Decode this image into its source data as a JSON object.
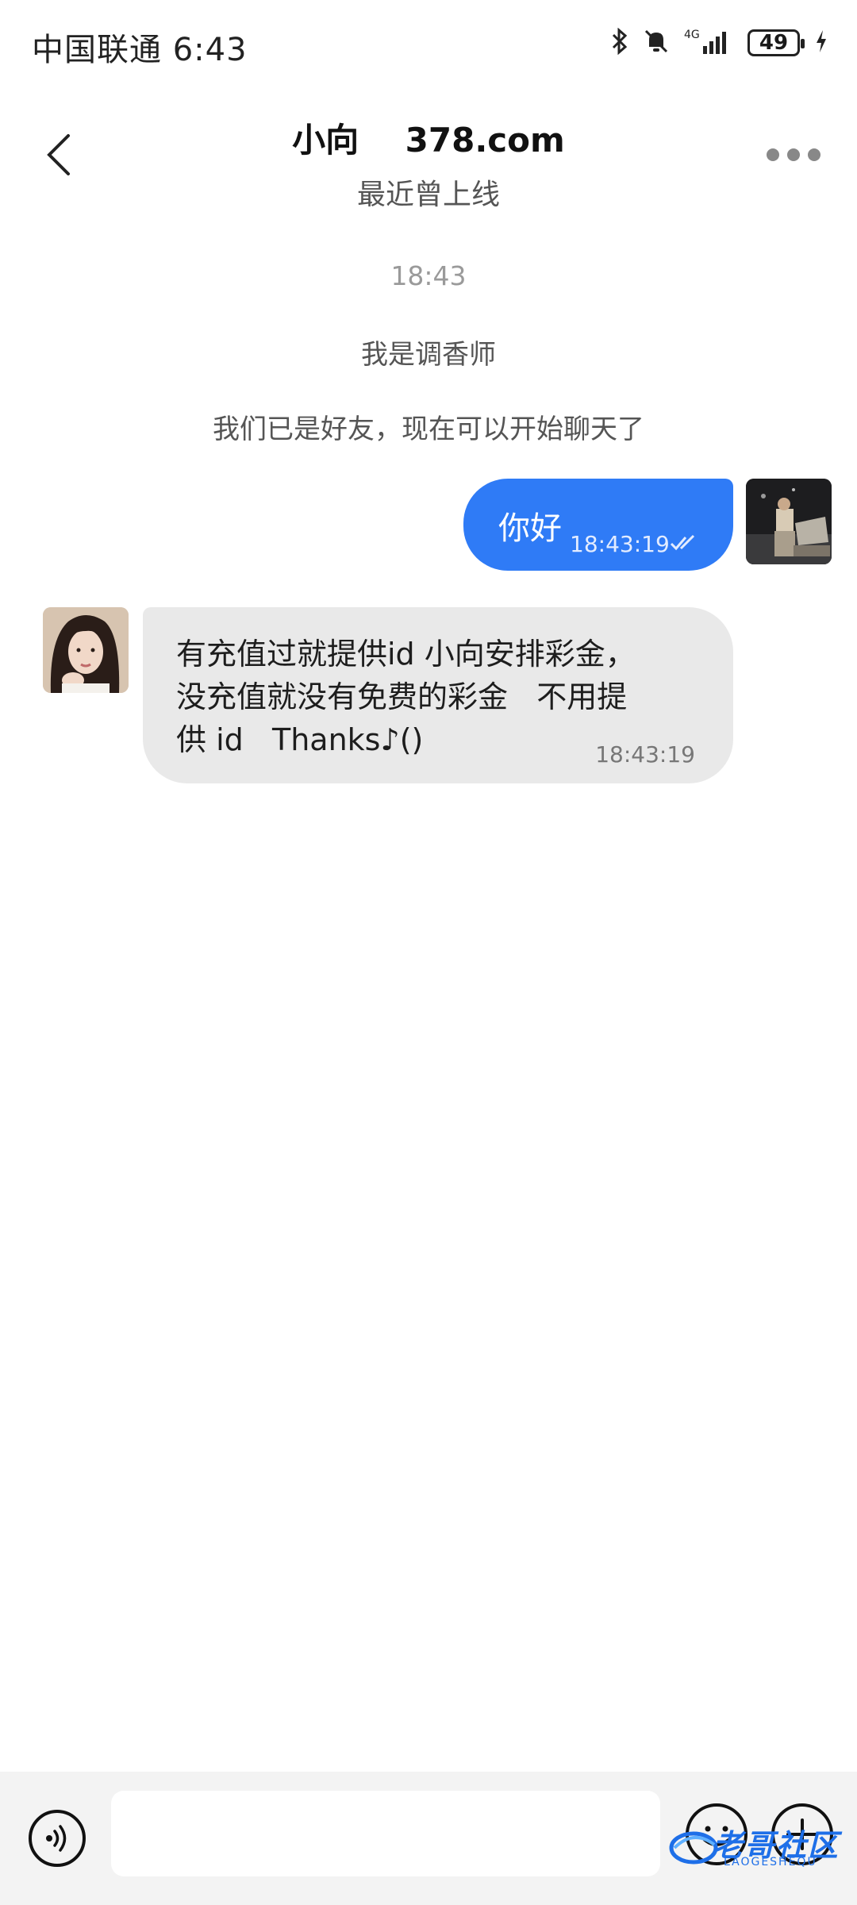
{
  "status_bar": {
    "carrier_time": "中国联通 6:43",
    "network": "4G",
    "battery": "49",
    "icons": [
      "bluetooth-icon",
      "mute-bell-icon",
      "signal-icon",
      "battery-icon",
      "charging-icon"
    ]
  },
  "header": {
    "title": "小向    378.com",
    "subtitle": "最近曾上线",
    "back_icon": "chevron-left-icon",
    "more_icon": "more-dots-icon"
  },
  "system_messages": {
    "time": "18:43",
    "bio": "我是调香师",
    "friend_notice": "我们已是好友，现在可以开始聊天了"
  },
  "messages": [
    {
      "direction": "outgoing",
      "text": "你好",
      "time": "18:43:19",
      "status_icon": "double-check-icon"
    },
    {
      "direction": "incoming",
      "text": "有充值过就提供id 小向安排彩金，\n没充值就没有免费的彩金   不用提\n供 id   Thanks♪()",
      "time": "18:43:19"
    }
  ],
  "input_bar": {
    "placeholder": "",
    "value": "",
    "voice_icon": "voice-icon",
    "emoji_icon": "emoji-icon",
    "plus_icon": "plus-icon"
  },
  "watermark": {
    "text": "老哥社区",
    "sub": "LAOGESHEQU"
  },
  "colors": {
    "outgoing_bubble": "#2f7bf6",
    "incoming_bubble": "#e9e9e9",
    "input_bar_bg": "#f3f3f3"
  }
}
